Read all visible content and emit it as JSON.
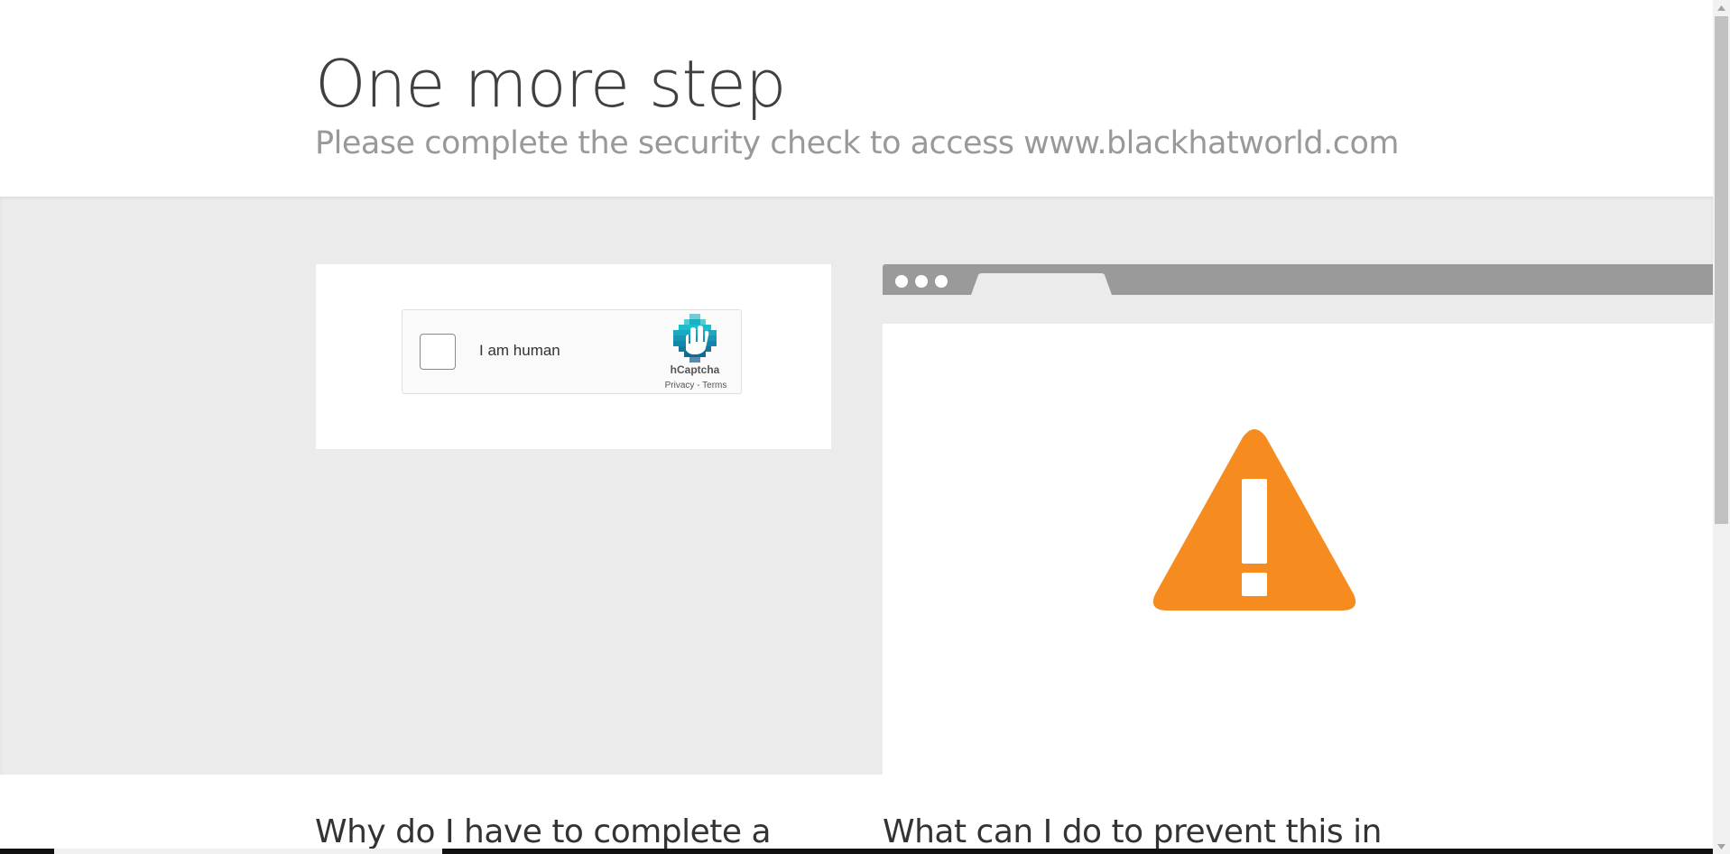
{
  "header": {
    "title": "One more step",
    "subtitle": "Please complete the security check to access www.blackhatworld.com"
  },
  "captcha": {
    "checkbox_label": "I am human",
    "brand": "hCaptcha",
    "privacy_link": "Privacy",
    "separator": "-",
    "terms_link": "Terms",
    "checked": false
  },
  "illustration": {
    "icon": "warning-triangle-icon",
    "icon_color": "#f68b1f"
  },
  "faq": {
    "left_heading": "Why do I have to complete a",
    "right_heading": "What can I do to prevent this in"
  }
}
